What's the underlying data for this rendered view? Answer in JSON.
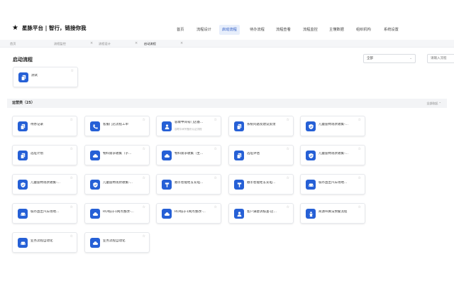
{
  "header": {
    "logo_text": "星脉平台 | 智行，链接你我",
    "nav": [
      {
        "label": "首页"
      },
      {
        "label": "流程设计"
      },
      {
        "label": "启动流程"
      },
      {
        "label": "待办流程"
      },
      {
        "label": "流程查看"
      },
      {
        "label": "流程监控"
      },
      {
        "label": "主懂数据"
      },
      {
        "label": "组织机构"
      },
      {
        "label": "系统设置"
      }
    ],
    "active_nav": "启动流程"
  },
  "tabs": [
    {
      "label": "首页"
    },
    {
      "label": "流程监控"
    },
    {
      "label": "流程设计"
    },
    {
      "label": "启动流程"
    }
  ],
  "page": {
    "title": "启动流程",
    "filter_value": "全部",
    "search_placeholder": "请输入流程"
  },
  "top_cards": [
    {
      "label": "测试",
      "icon": "copy-icon"
    }
  ],
  "section": {
    "title": "运营类（25）",
    "toggle_label": "全部收起"
  },
  "cards": [
    {
      "label": "待办记录",
      "sub": "",
      "icon": "copy-icon"
    },
    {
      "label": "客服门店流程工单",
      "sub": "",
      "icon": "phone-icon"
    },
    {
      "label": "容联中间号门店备...",
      "sub": "容联中间号备份认证流程",
      "icon": "user-icon"
    },
    {
      "label": "系统问题及建议反馈",
      "sub": "",
      "icon": "copy-icon"
    },
    {
      "label": "儿童座椅现状收集-...",
      "sub": "",
      "icon": "shield-icon"
    },
    {
      "label": "选址计划",
      "sub": "",
      "icon": "copy-icon"
    },
    {
      "label": "物料需求收集（子...",
      "sub": "",
      "icon": "cloud-icon"
    },
    {
      "label": "物料需求收集（主...",
      "sub": "",
      "icon": "cloud-icon"
    },
    {
      "label": "选址评估",
      "sub": "",
      "icon": "copy-icon"
    },
    {
      "label": "儿童座椅现状收集-...",
      "sub": "",
      "icon": "shield-icon"
    },
    {
      "label": "儿童座椅现状收集-...",
      "sub": "",
      "icon": "shield-icon"
    },
    {
      "label": "儿童座椅现状收集-...",
      "sub": "",
      "icon": "shield-icon"
    },
    {
      "label": "顺丰智能柜＆充电...",
      "sub": "",
      "icon": "cabinet-icon"
    },
    {
      "label": "顺丰智能柜＆充电...",
      "sub": "",
      "icon": "cabinet-icon"
    },
    {
      "label": "城市直出汽车场地...",
      "sub": "",
      "icon": "car-icon"
    },
    {
      "label": "城市直出汽车场地...",
      "sub": "",
      "icon": "car-icon"
    },
    {
      "label": "ROI低于1网点整改-...",
      "sub": "",
      "icon": "cloud-icon"
    },
    {
      "label": "ROI低于1网点整改-...",
      "sub": "",
      "icon": "cloud-icon"
    },
    {
      "label": "客户满意诉核查-店...",
      "sub": "",
      "icon": "user-icon"
    },
    {
      "label": "商源AI算法预警流程",
      "sub": "",
      "icon": "person-icon"
    },
    {
      "label": "业务流程自动化",
      "sub": "",
      "icon": "car-icon"
    },
    {
      "label": "业务流程自动化",
      "sub": "",
      "icon": "cloud-icon"
    }
  ],
  "colors": {
    "accent": "#2660d6",
    "active_nav_bg": "#e7eefb",
    "section_bg": "#f3f4f6"
  }
}
